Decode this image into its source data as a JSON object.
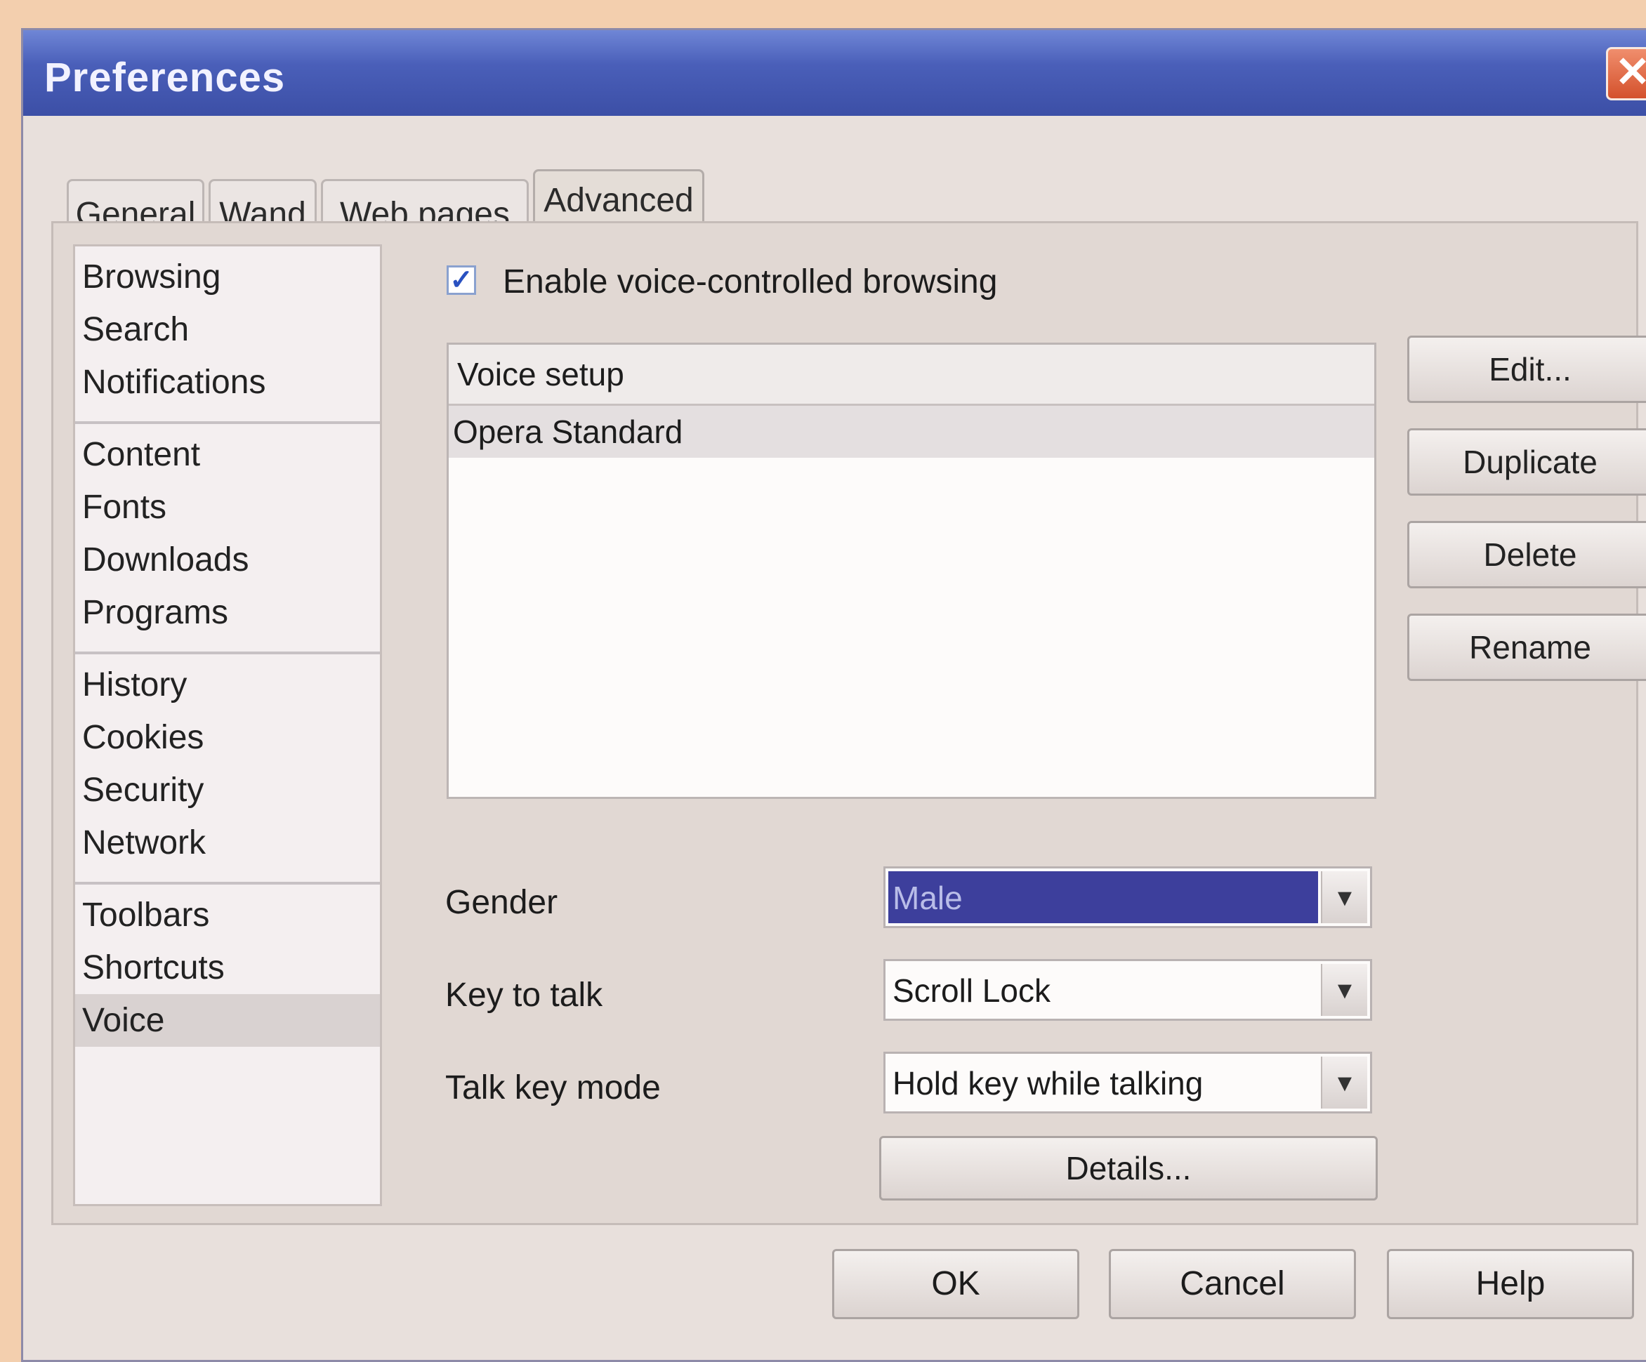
{
  "window": {
    "title": "Preferences",
    "close_glyph": "✕"
  },
  "tabs": [
    {
      "label": "General"
    },
    {
      "label": "Wand"
    },
    {
      "label": "Web pages"
    },
    {
      "label": "Advanced",
      "active": true
    }
  ],
  "categories": {
    "group1": [
      "Browsing",
      "Search",
      "Notifications"
    ],
    "group2": [
      "Content",
      "Fonts",
      "Downloads",
      "Programs"
    ],
    "group3": [
      "History",
      "Cookies",
      "Security",
      "Network"
    ],
    "group4": [
      "Toolbars",
      "Shortcuts",
      "Voice"
    ],
    "selected": "Voice"
  },
  "voice": {
    "enable_label": "Enable voice-controlled browsing",
    "enabled": true,
    "check_glyph": "✓",
    "table_header": "Voice setup",
    "rows": [
      "Opera Standard"
    ],
    "buttons": {
      "edit": "Edit...",
      "duplicate": "Duplicate",
      "delete": "Delete",
      "rename": "Rename"
    },
    "gender_label": "Gender",
    "gender_value": "Male",
    "key_label": "Key to talk",
    "key_value": "Scroll Lock",
    "mode_label": "Talk key mode",
    "mode_value": "Hold key while talking",
    "details_label": "Details...",
    "dropdown_glyph": "▼"
  },
  "footer": {
    "ok": "OK",
    "cancel": "Cancel",
    "help": "Help"
  },
  "colors": {
    "titlebar": "#3c4fa6",
    "selection": "#3d3f9c",
    "backdrop": "#f3cfae"
  }
}
